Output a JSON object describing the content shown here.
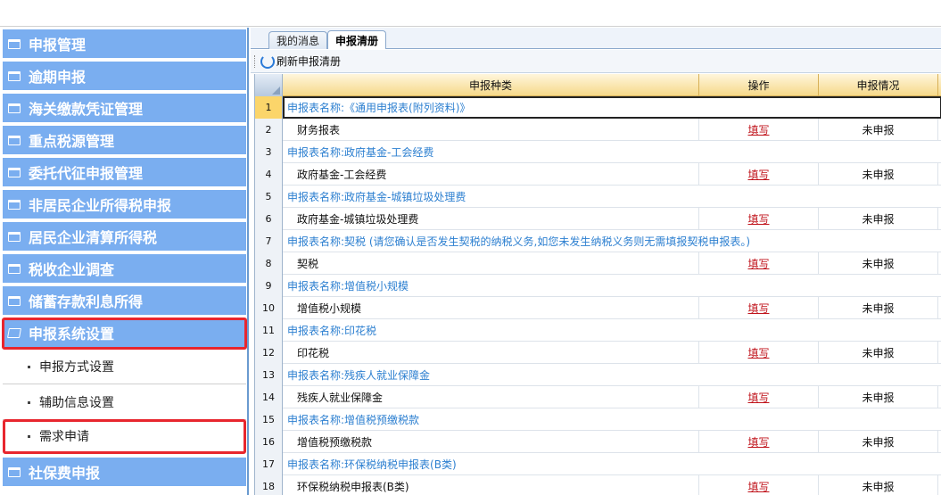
{
  "sidebar": {
    "menus": [
      {
        "label": "申报管理"
      },
      {
        "label": "逾期申报"
      },
      {
        "label": "海关缴款凭证管理"
      },
      {
        "label": "重点税源管理"
      },
      {
        "label": "委托代征申报管理"
      },
      {
        "label": "非居民企业所得税申报"
      },
      {
        "label": "居民企业清算所得税"
      },
      {
        "label": "税收企业调查"
      },
      {
        "label": "储蓄存款利息所得"
      },
      {
        "label": "申报系统设置"
      }
    ],
    "subitems": [
      {
        "label": "申报方式设置"
      },
      {
        "label": "辅助信息设置"
      },
      {
        "label": "需求申请"
      }
    ],
    "bottom_menu": {
      "label": "社保费申报"
    }
  },
  "tabs": {
    "tab1": "我的消息",
    "tab2": "申报清册"
  },
  "toolbar": {
    "refresh_label": "刷新申报清册"
  },
  "grid": {
    "headers": {
      "type": "申报种类",
      "op": "操作",
      "status": "申报情况"
    },
    "rows": [
      {
        "n": "1",
        "kind": "group",
        "text": "申报表名称:《通用申报表(附列资料)》"
      },
      {
        "n": "2",
        "kind": "item",
        "text": "财务报表",
        "op": "填写",
        "status": "未申报"
      },
      {
        "n": "3",
        "kind": "group",
        "text": "申报表名称:政府基金-工会经费"
      },
      {
        "n": "4",
        "kind": "item",
        "text": "政府基金-工会经费",
        "op": "填写",
        "status": "未申报"
      },
      {
        "n": "5",
        "kind": "group",
        "text": "申报表名称:政府基金-城镇垃圾处理费"
      },
      {
        "n": "6",
        "kind": "item",
        "text": "政府基金-城镇垃圾处理费",
        "op": "填写",
        "status": "未申报"
      },
      {
        "n": "7",
        "kind": "group",
        "text": "申报表名称:契税 (请您确认是否发生契税的纳税义务,如您未发生纳税义务则无需填报契税申报表。)"
      },
      {
        "n": "8",
        "kind": "item",
        "text": "契税",
        "op": "填写",
        "status": "未申报"
      },
      {
        "n": "9",
        "kind": "group",
        "text": "申报表名称:增值税小规模"
      },
      {
        "n": "10",
        "kind": "item",
        "text": "增值税小规模",
        "op": "填写",
        "status": "未申报"
      },
      {
        "n": "11",
        "kind": "group",
        "text": "申报表名称:印花税"
      },
      {
        "n": "12",
        "kind": "item",
        "text": "印花税",
        "op": "填写",
        "status": "未申报"
      },
      {
        "n": "13",
        "kind": "group",
        "text": "申报表名称:残疾人就业保障金"
      },
      {
        "n": "14",
        "kind": "item",
        "text": "残疾人就业保障金",
        "op": "填写",
        "status": "未申报"
      },
      {
        "n": "15",
        "kind": "group",
        "text": "申报表名称:增值税预缴税款"
      },
      {
        "n": "16",
        "kind": "item",
        "text": "增值税预缴税款",
        "op": "填写",
        "status": "未申报"
      },
      {
        "n": "17",
        "kind": "group",
        "text": "申报表名称:环保税纳税申报表(B类)"
      },
      {
        "n": "18",
        "kind": "item",
        "text": "环保税纳税申报表(B类)",
        "op": "填写",
        "status": "未申报"
      }
    ]
  }
}
